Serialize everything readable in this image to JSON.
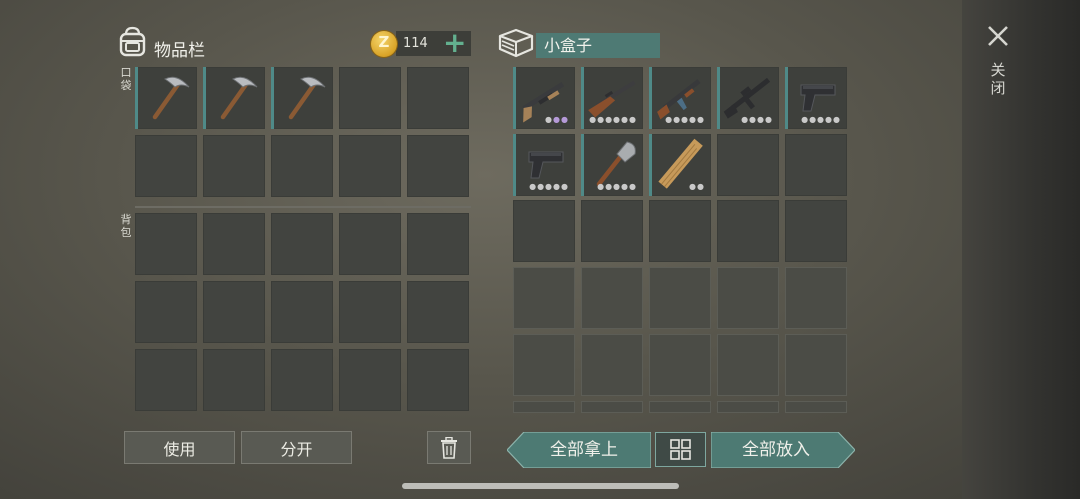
{
  "inventory": {
    "title": "物品栏",
    "coins": "114",
    "coin_symbol": "Z",
    "add_label": "+",
    "pocket_label": "口袋",
    "backpack_label": "背包",
    "pocket_items": [
      "pickaxe",
      "pickaxe",
      "pickaxe"
    ]
  },
  "container": {
    "name": "小盒子",
    "items": [
      {
        "icon": "shotgun-icon",
        "dots": 3,
        "purple": 2
      },
      {
        "icon": "rifle-icon",
        "dots": 6,
        "purple": 0
      },
      {
        "icon": "ak-rifle-icon",
        "dots": 5,
        "purple": 0
      },
      {
        "icon": "m16-rifle-icon",
        "dots": 4,
        "purple": 0
      },
      {
        "icon": "pistol-icon",
        "dots": 5,
        "purple": 0
      },
      {
        "icon": "pistol-icon",
        "dots": 5,
        "purple": 0
      },
      {
        "icon": "shovel-icon",
        "dots": 5,
        "purple": 0
      },
      {
        "icon": "wood-plank-icon",
        "dots": 2,
        "purple": 0
      }
    ]
  },
  "buttons": {
    "use": "使用",
    "split": "分开",
    "take_all": "全部拿上",
    "put_all": "全部放入"
  },
  "close_label": "关闭",
  "colors": {
    "teal": "#4d7a73",
    "slot": "#424440",
    "accent_bar": "#4f8a88",
    "coin": "#d9a326"
  }
}
